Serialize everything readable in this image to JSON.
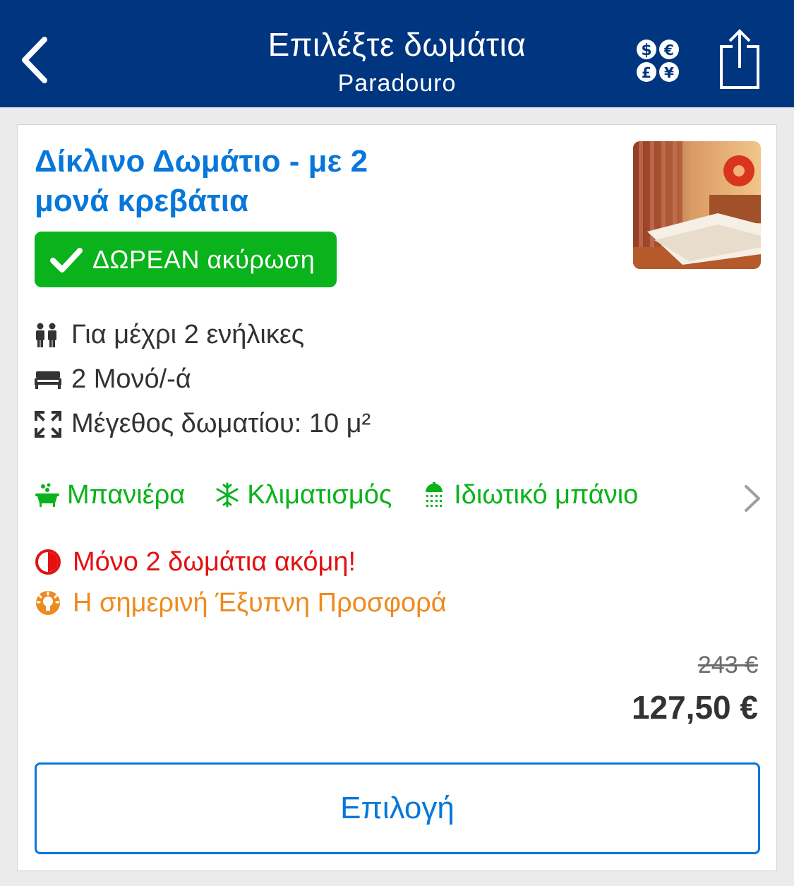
{
  "header": {
    "title": "Επιλέξτε δωμάτια",
    "subtitle": "Paradouro",
    "back_icon": "chevron-left-icon",
    "currency_icon": "currency-icon",
    "share_icon": "share-icon",
    "bg_color": "#003580"
  },
  "room": {
    "title_line1": "Δίκλινο Δωμάτιο - με 2",
    "title_line2": "μονά κρεβάτια",
    "photo_icon": "room-photo",
    "free_cancellation": "ΔΩΡΕΑΝ ακύρωση",
    "facts": [
      {
        "icon": "guests-icon",
        "text": "Για μέχρι 2 ενήλικες"
      },
      {
        "icon": "bed-icon",
        "text": "2 Μονό/-ά"
      },
      {
        "icon": "room-size-icon",
        "text": "Μέγεθος δωματίου: 10 μ²"
      }
    ],
    "amenities": [
      {
        "icon": "bathtub-icon",
        "text": "Μπανιέρα"
      },
      {
        "icon": "snowflake-icon",
        "text": "Κλιματισμός"
      },
      {
        "icon": "shower-icon",
        "text": "Ιδιωτικό μπάνιο"
      }
    ],
    "alerts": {
      "rooms_left": "Μόνο 2 δωμάτια ακόμη!",
      "smart_deal": "Η σημερινή Έξυπνη Προσφορά"
    },
    "price_old": "243 €",
    "price_new": "127,50 €",
    "select_label": "Επιλογή"
  },
  "colors": {
    "brand_blue": "#003580",
    "link_blue": "#0777da",
    "green": "#0ab21b",
    "red": "#e31111",
    "orange": "#ed8b1f"
  }
}
